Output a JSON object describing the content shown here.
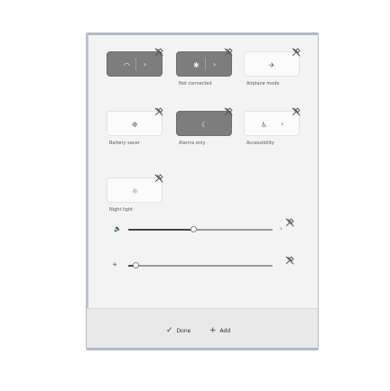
{
  "tiles": [
    {
      "id": "wifi",
      "label": "",
      "state": "on",
      "split": true,
      "icon": "wifi-icon",
      "glyph": "◠",
      "chevron": "›"
    },
    {
      "id": "bluetooth",
      "label": "Not connected",
      "state": "on",
      "split": true,
      "icon": "bluetooth-icon",
      "glyph": "✱",
      "chevron": "›"
    },
    {
      "id": "airplane",
      "label": "Airplane mode",
      "state": "off",
      "split": false,
      "icon": "airplane-icon",
      "glyph": "✈"
    },
    {
      "id": "battery-saver",
      "label": "Battery saver",
      "state": "off",
      "split": false,
      "icon": "battery-saver-icon",
      "glyph": "❉"
    },
    {
      "id": "focus-assist",
      "label": "Alarms only",
      "state": "on",
      "split": false,
      "icon": "moon-icon",
      "glyph": "☾"
    },
    {
      "id": "accessibility",
      "label": "Accessibility",
      "state": "off",
      "split": true,
      "icon": "accessibility-icon",
      "glyph": "♿",
      "chevron": "›"
    },
    {
      "id": "night-light",
      "label": "Night light",
      "state": "off",
      "split": false,
      "icon": "sun-icon",
      "glyph": "☼"
    }
  ],
  "sliders": [
    {
      "id": "volume",
      "icon": "speaker-icon",
      "glyph": "🔈",
      "value": 0.45
    },
    {
      "id": "brightness",
      "icon": "brightness-icon",
      "glyph": "☀",
      "value": 0.05
    }
  ],
  "footer": {
    "done_icon": "✓",
    "done_label": "Done",
    "add_icon": "+",
    "add_label": "Add"
  },
  "colors": {
    "accent_on": "#7d7d7d",
    "tile_off": "#fbfbfb",
    "panel_bg": "#f3f3f3",
    "footer_bg": "#e9e9e9",
    "slider_fill": "#444444",
    "slider_rest": "#9a9a9a"
  }
}
